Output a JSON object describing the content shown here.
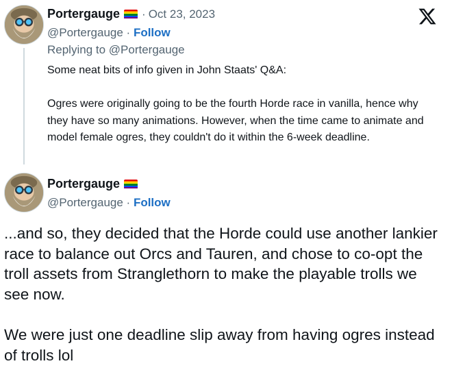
{
  "tweet1": {
    "display_name": "Portergauge",
    "separator": "·",
    "date": "Oct 23, 2023",
    "handle": "@Portergauge",
    "handle_sep": " · ",
    "follow_label": "Follow",
    "replying_to": "Replying to @Portergauge",
    "paragraphs": [
      "Some neat bits of info given in John Staats' Q&A:",
      "Ogres were originally going to be the fourth Horde race in vanilla, hence why they have so many animations. However, when the time came to animate and model female ogres, they couldn't do it within the 6-week deadline."
    ]
  },
  "tweet2": {
    "display_name": "Portergauge",
    "handle": "@Portergauge",
    "handle_sep": " · ",
    "follow_label": "Follow",
    "paragraphs": [
      "...and so, they decided that the Horde could use another lankier race to balance out Orcs and Tauren, and chose to co-opt the troll assets from Stranglethorn to make the playable trolls we see now.",
      "We were just one deadline slip away from having ogres instead of trolls lol"
    ]
  },
  "icons": {
    "logo": "x-logo-icon",
    "flag": "rainbow-flag-icon",
    "avatar": "avatar-image"
  },
  "colors": {
    "follow": "#1d6fc4",
    "secondary_text": "#536471",
    "thread_line": "#cfd9de",
    "flag_stripes": [
      "#e40303",
      "#ff8c00",
      "#ffed00",
      "#008026",
      "#004dff",
      "#750787"
    ]
  }
}
